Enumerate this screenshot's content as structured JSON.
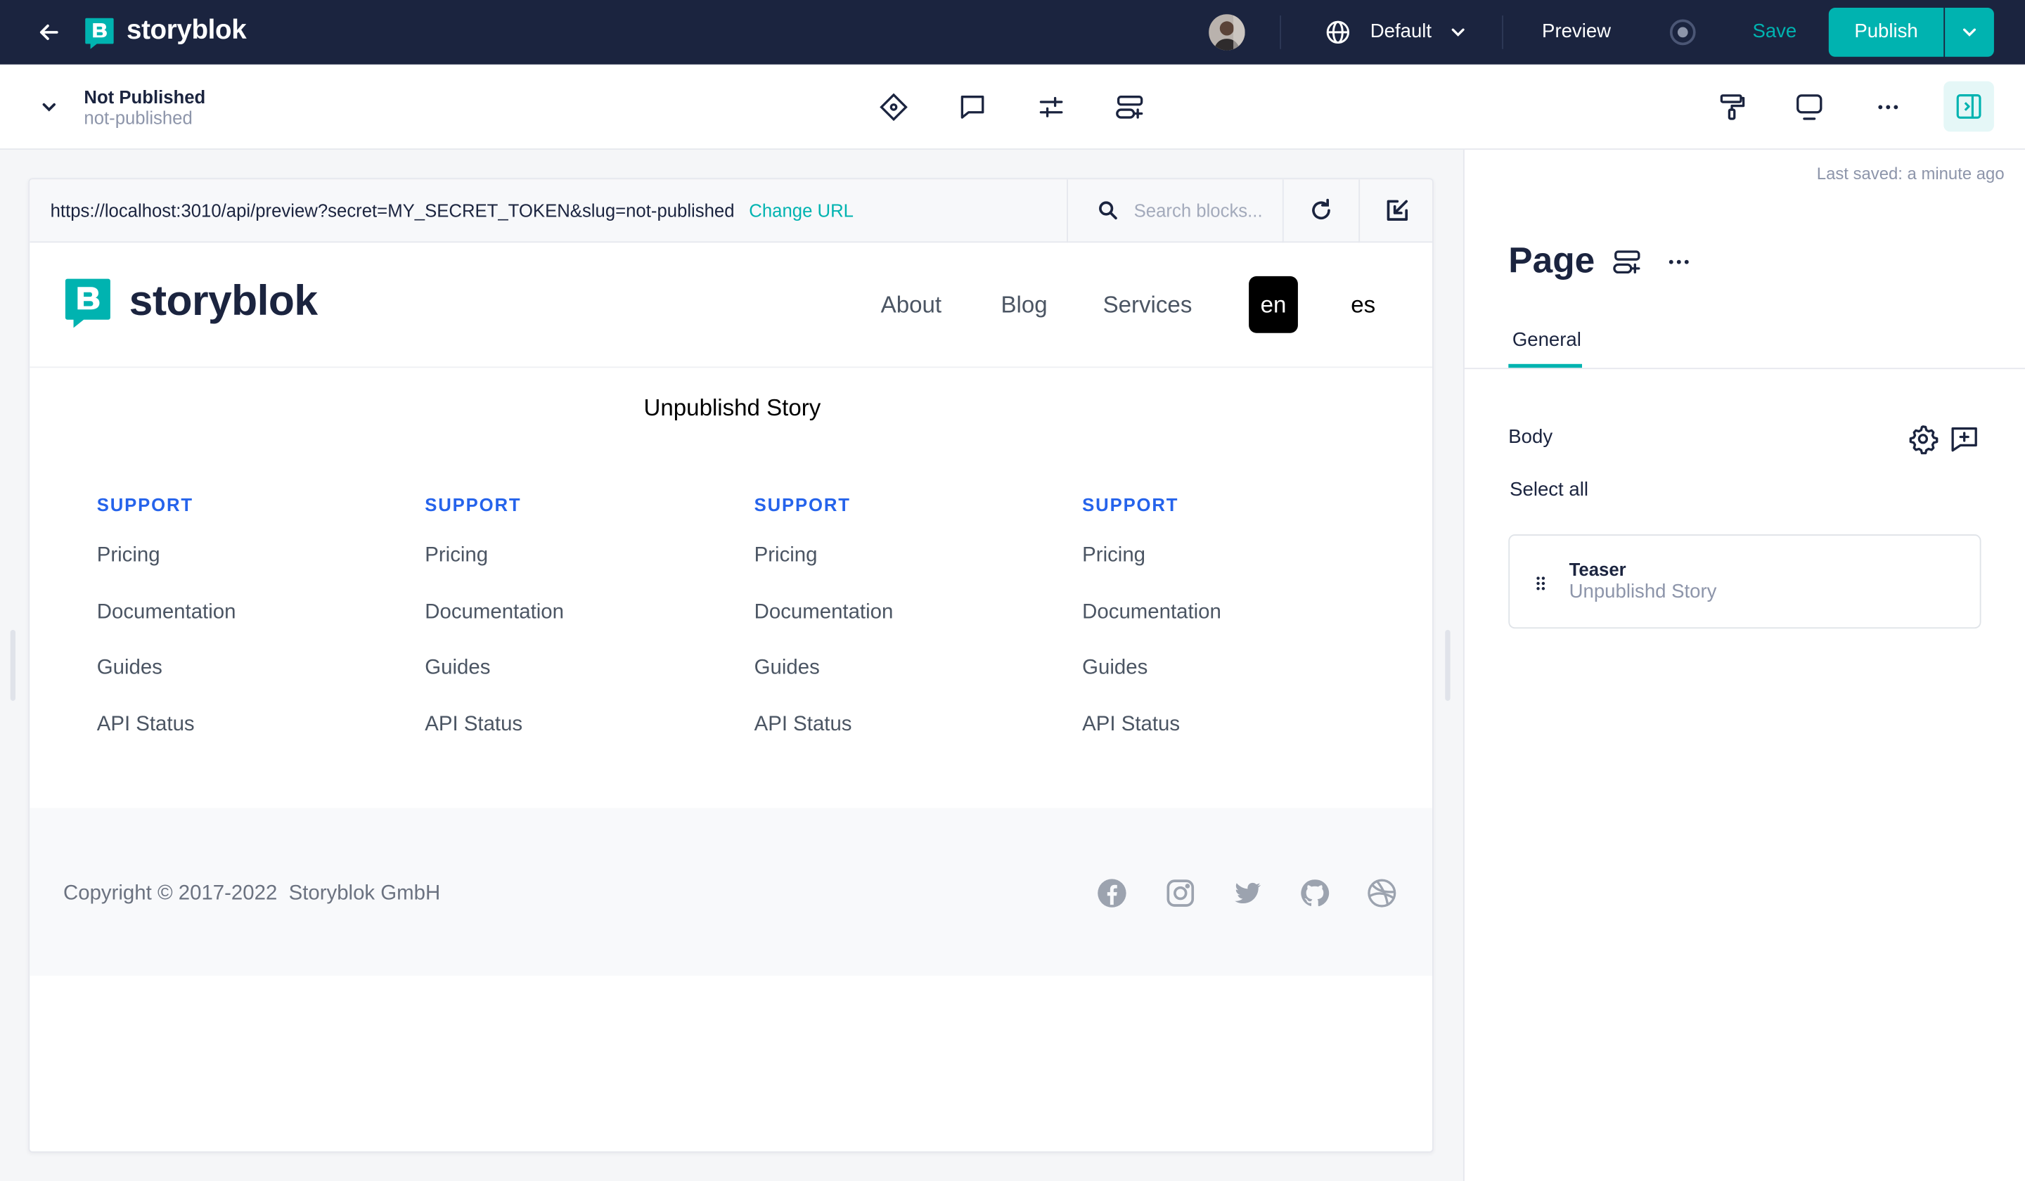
{
  "topbar": {
    "brand": "storyblok",
    "language": "Default",
    "preview_label": "Preview",
    "save_label": "Save",
    "publish_label": "Publish"
  },
  "subbar": {
    "status": "Not Published",
    "slug": "not-published"
  },
  "preview": {
    "url": "https://localhost:3010/api/preview?secret=MY_SECRET_TOKEN&slug=not-published",
    "change_url": "Change URL",
    "search_placeholder": "Search blocks...",
    "site": {
      "brand": "storyblok",
      "nav": [
        "About",
        "Blog",
        "Services"
      ],
      "languages": [
        "en",
        "es"
      ],
      "active_language": "en"
    },
    "story_title": "Unpublishd Story",
    "footer_columns": [
      {
        "heading": "SUPPORT",
        "links": [
          "Pricing",
          "Documentation",
          "Guides",
          "API Status"
        ]
      },
      {
        "heading": "SUPPORT",
        "links": [
          "Pricing",
          "Documentation",
          "Guides",
          "API Status"
        ]
      },
      {
        "heading": "SUPPORT",
        "links": [
          "Pricing",
          "Documentation",
          "Guides",
          "API Status"
        ]
      },
      {
        "heading": "SUPPORT",
        "links": [
          "Pricing",
          "Documentation",
          "Guides",
          "API Status"
        ]
      }
    ],
    "copyright": "Copyright © 2017-2022  Storyblok GmbH",
    "social_icons": [
      "facebook-icon",
      "instagram-icon",
      "twitter-icon",
      "github-icon",
      "dribbble-icon"
    ]
  },
  "panel": {
    "last_saved": "Last saved: a minute ago",
    "title": "Page",
    "tabs": [
      "General"
    ],
    "field_label": "Body",
    "select_all": "Select all",
    "blocks": [
      {
        "name": "Teaser",
        "subtitle": "Unpublishd Story"
      }
    ]
  },
  "colors": {
    "topbar_bg": "#1b243f",
    "accent": "#00b3b0",
    "link_blue": "#2563eb"
  }
}
